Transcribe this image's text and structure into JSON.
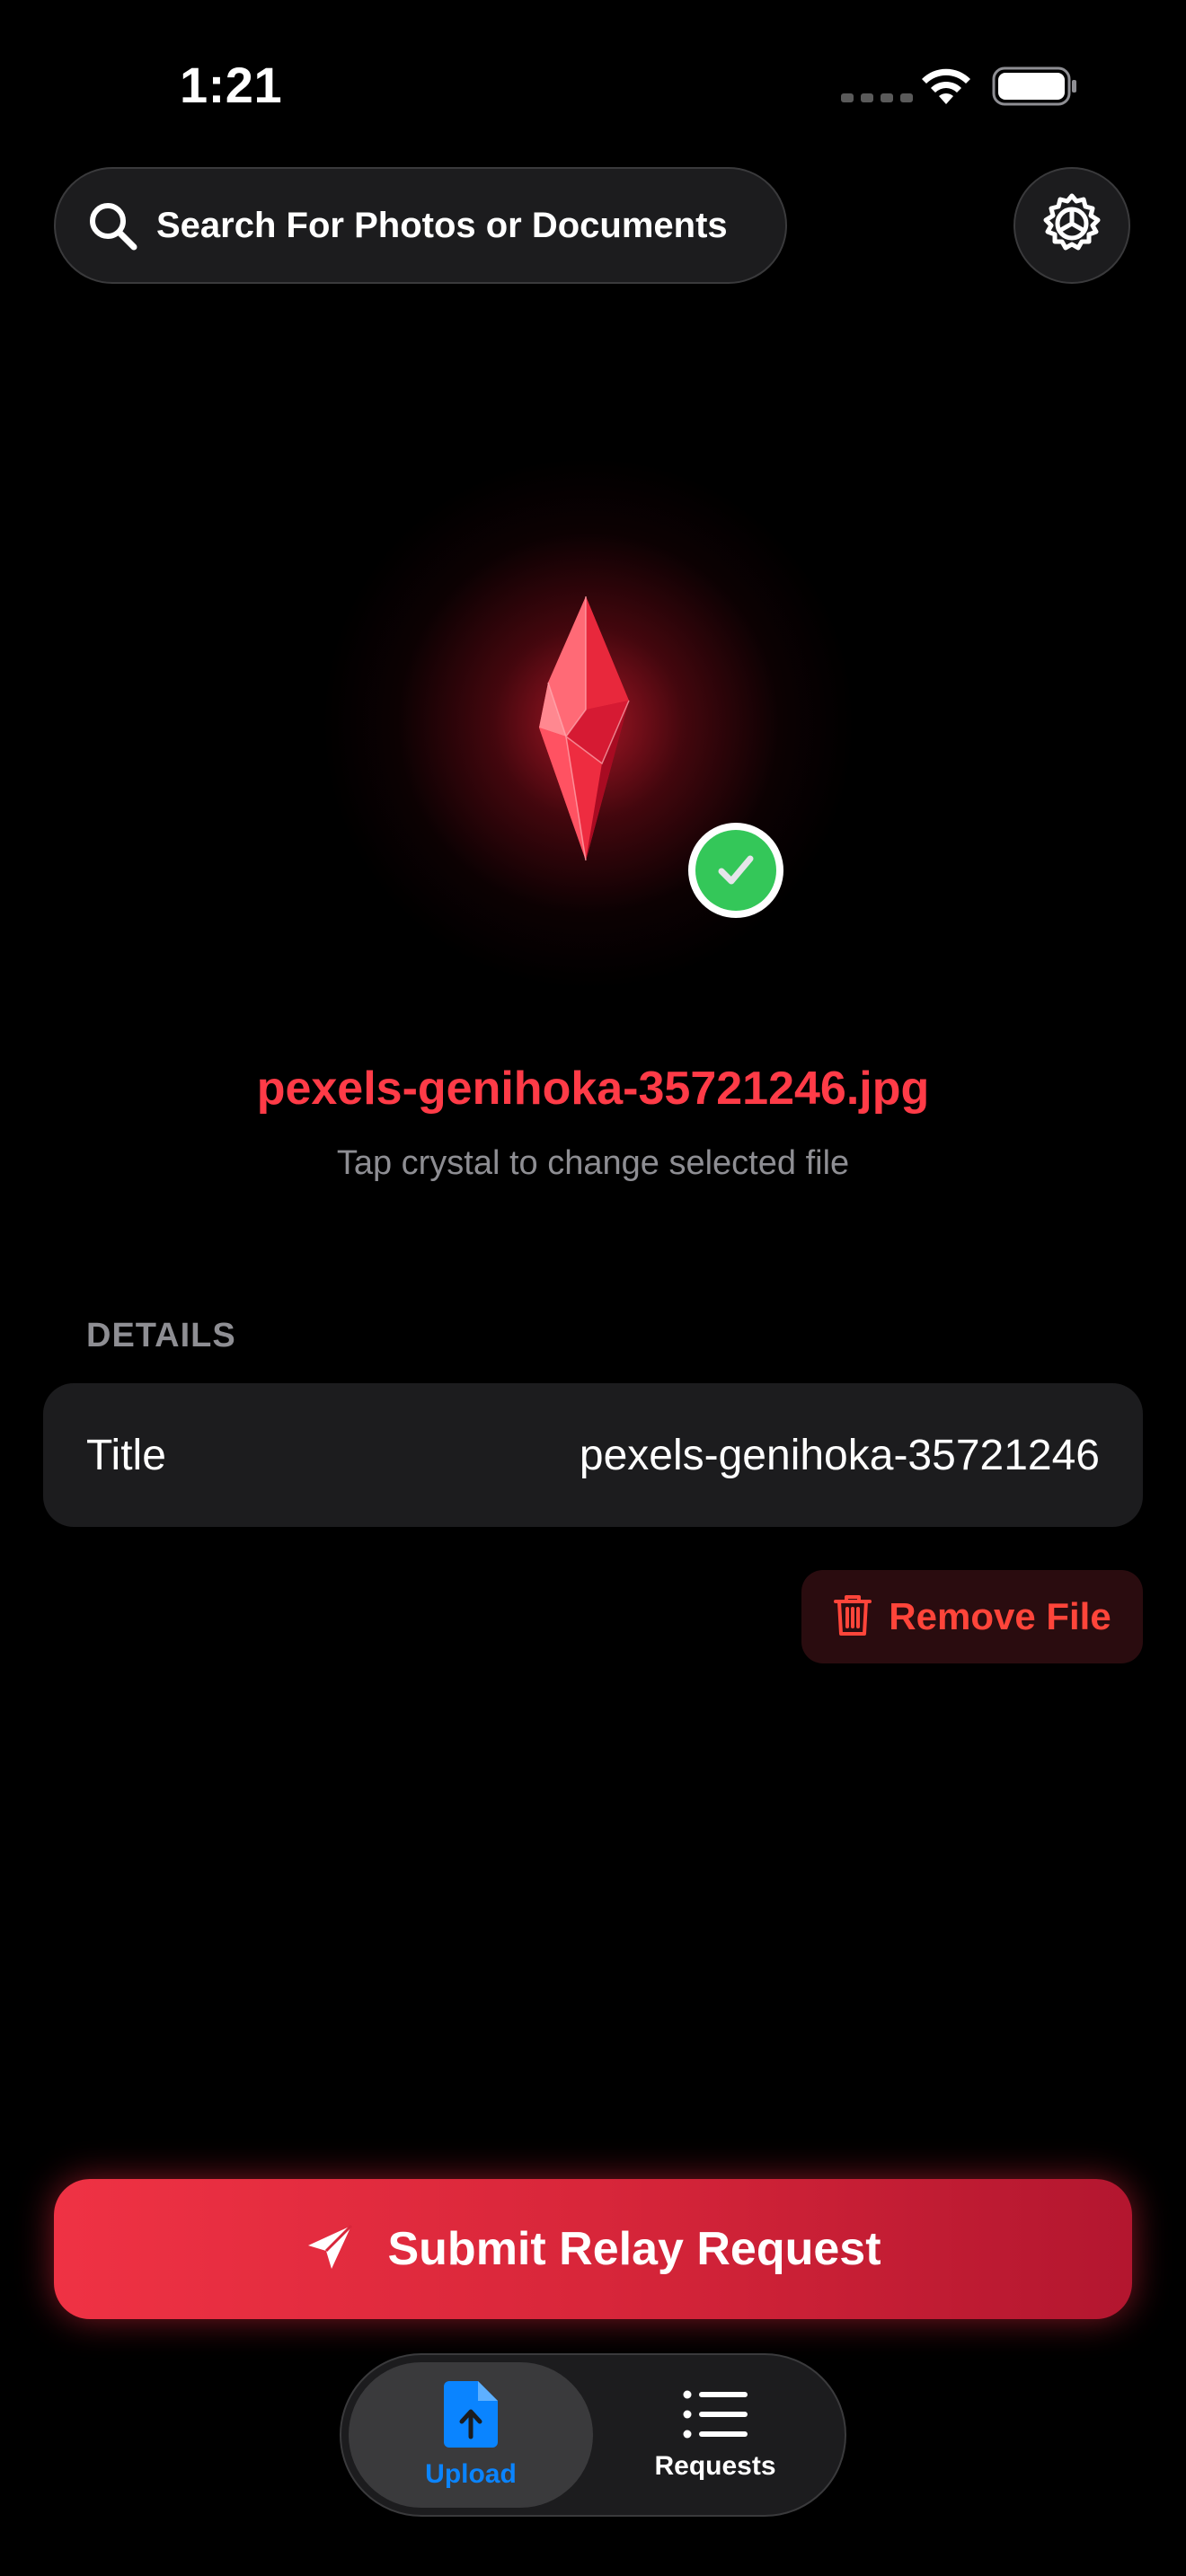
{
  "status_bar": {
    "time": "1:21"
  },
  "search": {
    "label": "Search For Photos or Documents",
    "icon": "search-icon"
  },
  "settings": {
    "icon": "gear-icon"
  },
  "file": {
    "name": "pexels-genihoka-35721246.jpg",
    "hint": "Tap crystal to change selected file",
    "selected": true
  },
  "details": {
    "header": "DETAILS",
    "rows": [
      {
        "label": "Title",
        "value": "pexels-genihoka-35721246"
      }
    ]
  },
  "remove_button": {
    "label": "Remove File",
    "icon": "trash-icon"
  },
  "submit_button": {
    "label": "Submit Relay Request",
    "icon": "paper-plane-icon"
  },
  "tabs": [
    {
      "label": "Upload",
      "icon": "upload-document-icon",
      "active": true
    },
    {
      "label": "Requests",
      "icon": "list-icon",
      "active": false
    }
  ],
  "colors": {
    "accent_red": "#ff3b47",
    "active_tab_blue": "#0a84ff",
    "success_green": "#34c759",
    "background": "#000000",
    "card": "#1c1c1e"
  }
}
